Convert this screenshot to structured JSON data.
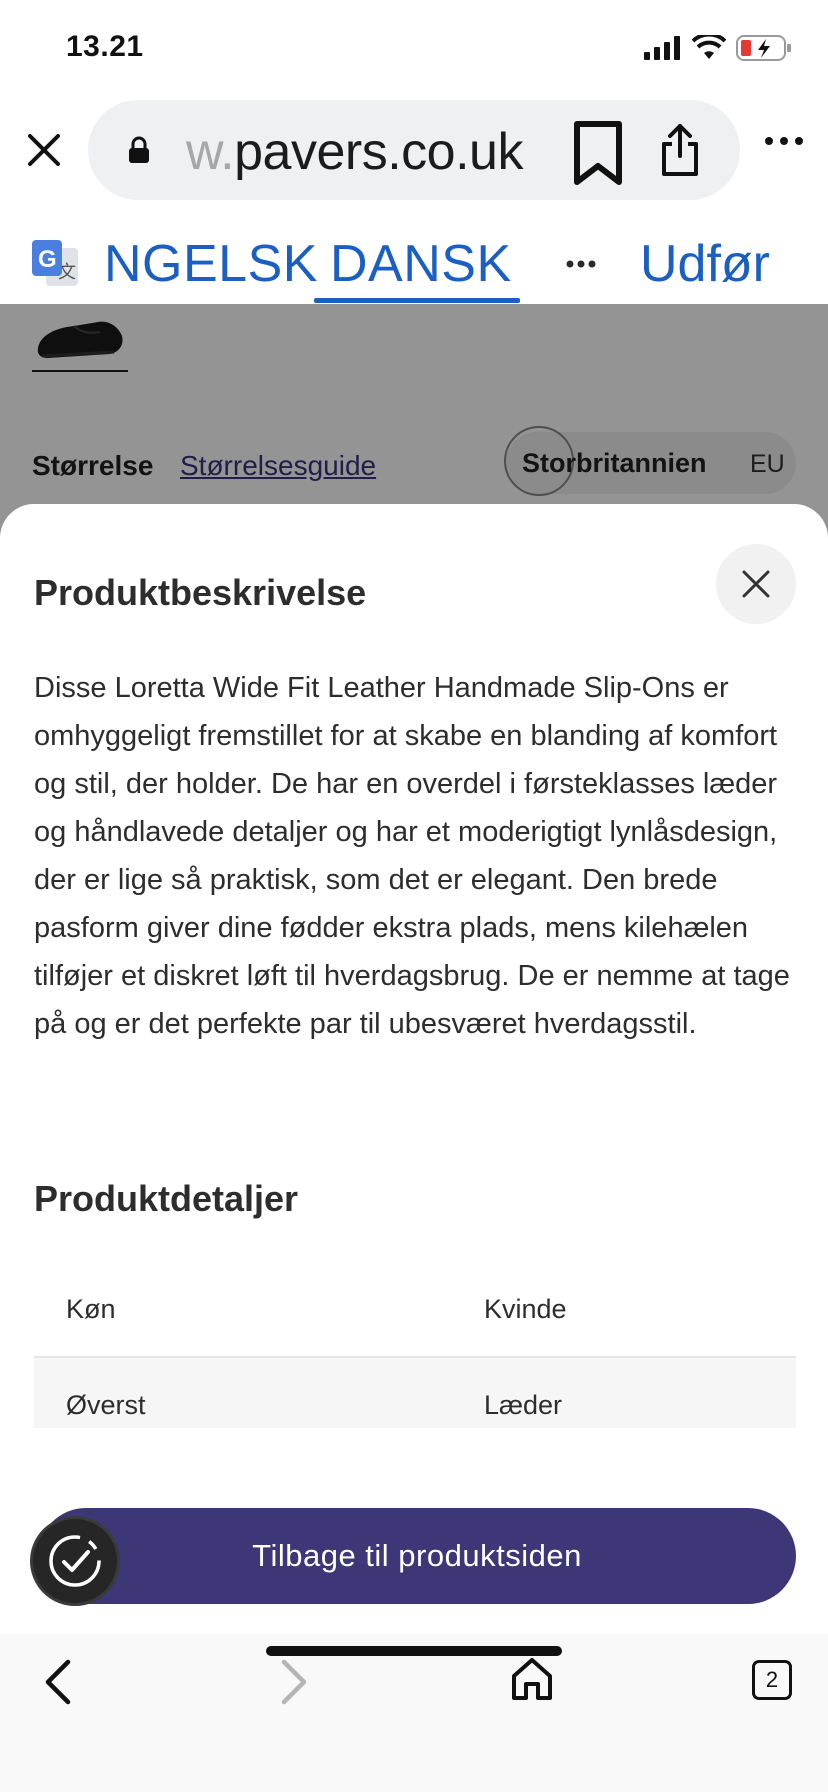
{
  "status_bar": {
    "time": "13.21"
  },
  "browser": {
    "url_faded": "w.",
    "url_main": "pavers.co.uk"
  },
  "translate": {
    "source_lang": "NGELSK",
    "target_lang": "DANSK",
    "done_label": "Udfør"
  },
  "page": {
    "size_label": "Størrelse",
    "size_guide_link": "Størrelsesguide",
    "region_uk": "Storbritannien",
    "region_eu": "EU"
  },
  "sheet": {
    "title": "Produktbeskrivelse",
    "description": "Disse Loretta Wide Fit Leather Handmade Slip-Ons er omhyggeligt fremstillet for at skabe en blanding af komfort og stil, der holder. De har en overdel i førsteklasses læder og håndlavede detaljer og har et moderigtigt lynlåsdesign, der er lige så praktisk, som det er elegant. Den brede pasform giver dine fødder ekstra plads, mens kilehælen tilføjer et diskret løft til hverdagsbrug. De er nemme at tage på og er det perfekte par til ubesværet hverdagsstil.",
    "details_title": "Produktdetaljer",
    "details": [
      {
        "key": "Køn",
        "value": "Kvinde"
      },
      {
        "key": "Øverst",
        "value": "Læder"
      }
    ],
    "back_button": "Tilbage til produktsiden"
  },
  "bottom_nav": {
    "tab_count": "2"
  },
  "colors": {
    "accent_blue": "#1a5fc1",
    "button_purple": "#3d3677"
  }
}
